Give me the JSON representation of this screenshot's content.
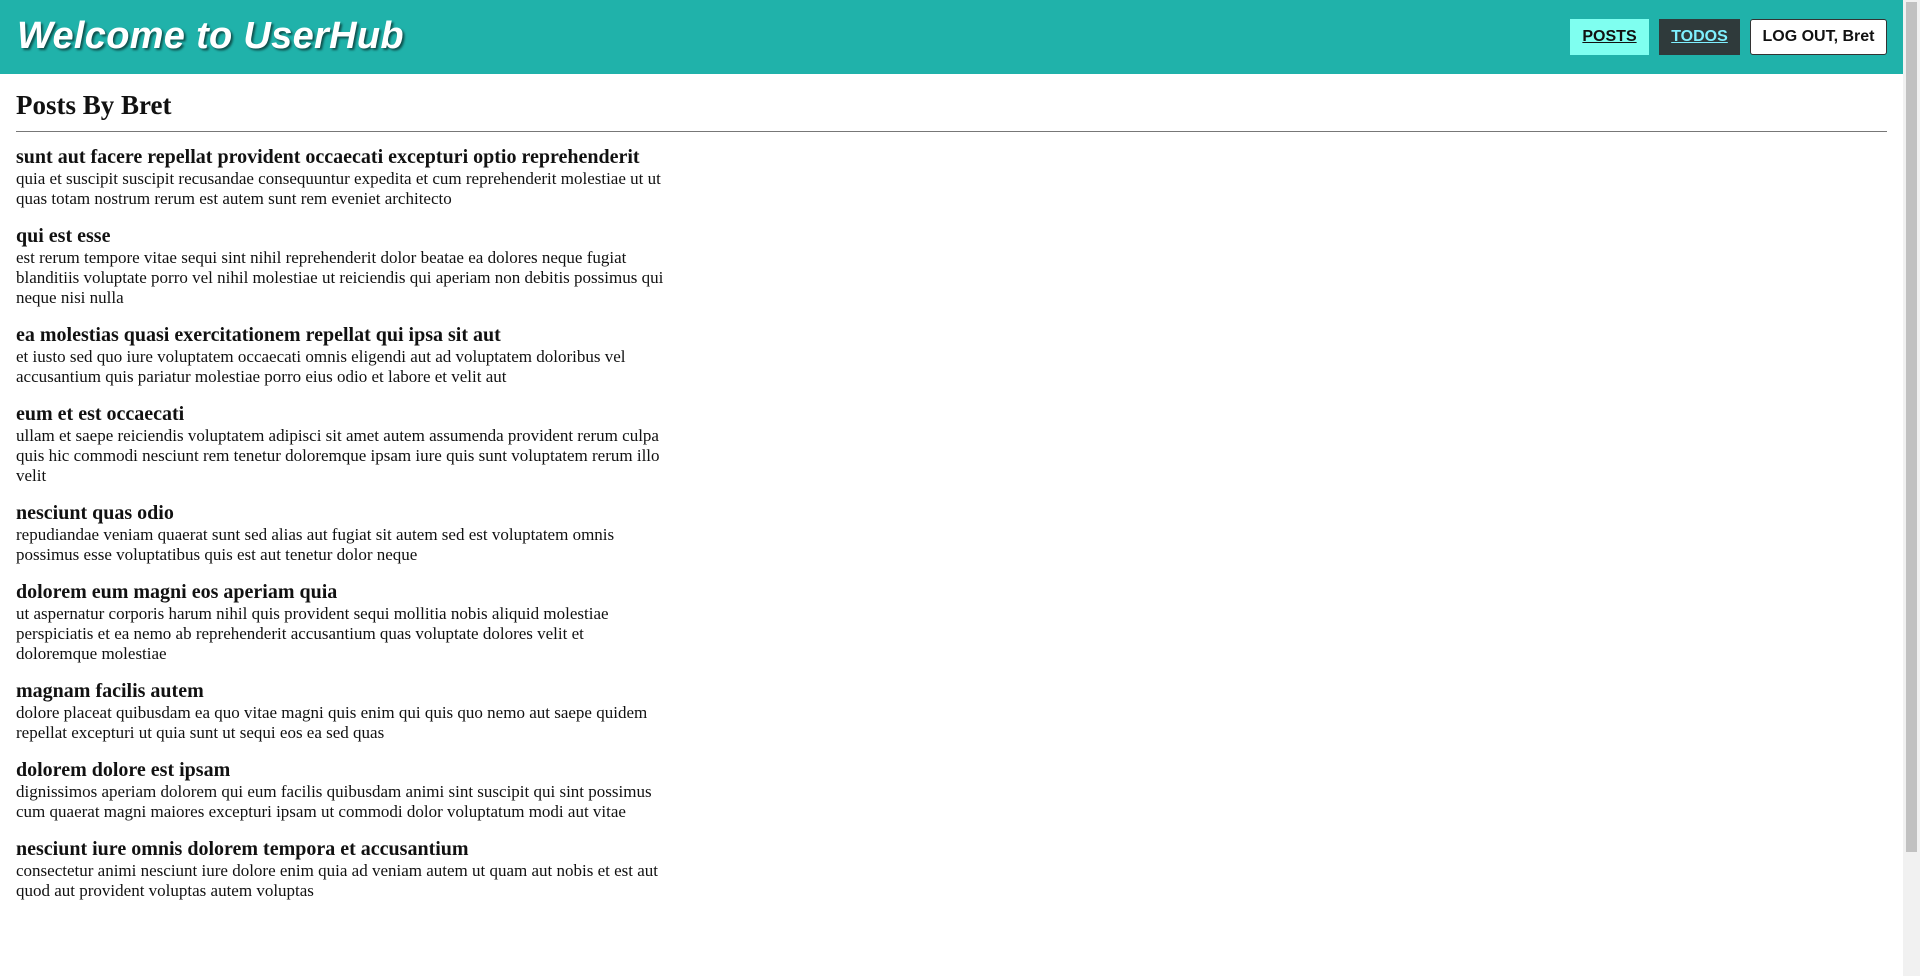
{
  "header": {
    "brand": "Welcome to UserHub",
    "nav": {
      "posts_label": "POSTS",
      "todos_label": "TODOS",
      "logout_label": "LOG OUT, Bret"
    },
    "colors": {
      "header_bg": "#20b2aa",
      "posts_bg": "#7ffff0",
      "todos_bg": "#2f3a3b"
    }
  },
  "page": {
    "title": "Posts By Bret"
  },
  "posts": [
    {
      "title": "sunt aut facere repellat provident occaecati excepturi optio reprehenderit",
      "body": "quia et suscipit suscipit recusandae consequuntur expedita et cum reprehenderit molestiae ut ut quas totam nostrum rerum est autem sunt rem eveniet architecto"
    },
    {
      "title": "qui est esse",
      "body": "est rerum tempore vitae sequi sint nihil reprehenderit dolor beatae ea dolores neque fugiat blanditiis voluptate porro vel nihil molestiae ut reiciendis qui aperiam non debitis possimus qui neque nisi nulla"
    },
    {
      "title": "ea molestias quasi exercitationem repellat qui ipsa sit aut",
      "body": "et iusto sed quo iure voluptatem occaecati omnis eligendi aut ad voluptatem doloribus vel accusantium quis pariatur molestiae porro eius odio et labore et velit aut"
    },
    {
      "title": "eum et est occaecati",
      "body": "ullam et saepe reiciendis voluptatem adipisci sit amet autem assumenda provident rerum culpa quis hic commodi nesciunt rem tenetur doloremque ipsam iure quis sunt voluptatem rerum illo velit"
    },
    {
      "title": "nesciunt quas odio",
      "body": "repudiandae veniam quaerat sunt sed alias aut fugiat sit autem sed est voluptatem omnis possimus esse voluptatibus quis est aut tenetur dolor neque"
    },
    {
      "title": "dolorem eum magni eos aperiam quia",
      "body": "ut aspernatur corporis harum nihil quis provident sequi mollitia nobis aliquid molestiae perspiciatis et ea nemo ab reprehenderit accusantium quas voluptate dolores velit et doloremque molestiae"
    },
    {
      "title": "magnam facilis autem",
      "body": "dolore placeat quibusdam ea quo vitae magni quis enim qui quis quo nemo aut saepe quidem repellat excepturi ut quia sunt ut sequi eos ea sed quas"
    },
    {
      "title": "dolorem dolore est ipsam",
      "body": "dignissimos aperiam dolorem qui eum facilis quibusdam animi sint suscipit qui sint possimus cum quaerat magni maiores excepturi ipsam ut commodi dolor voluptatum modi aut vitae"
    },
    {
      "title": "nesciunt iure omnis dolorem tempora et accusantium",
      "body": "consectetur animi nesciunt iure dolore enim quia ad veniam autem ut quam aut nobis et est aut quod aut provident voluptas autem voluptas"
    }
  ]
}
